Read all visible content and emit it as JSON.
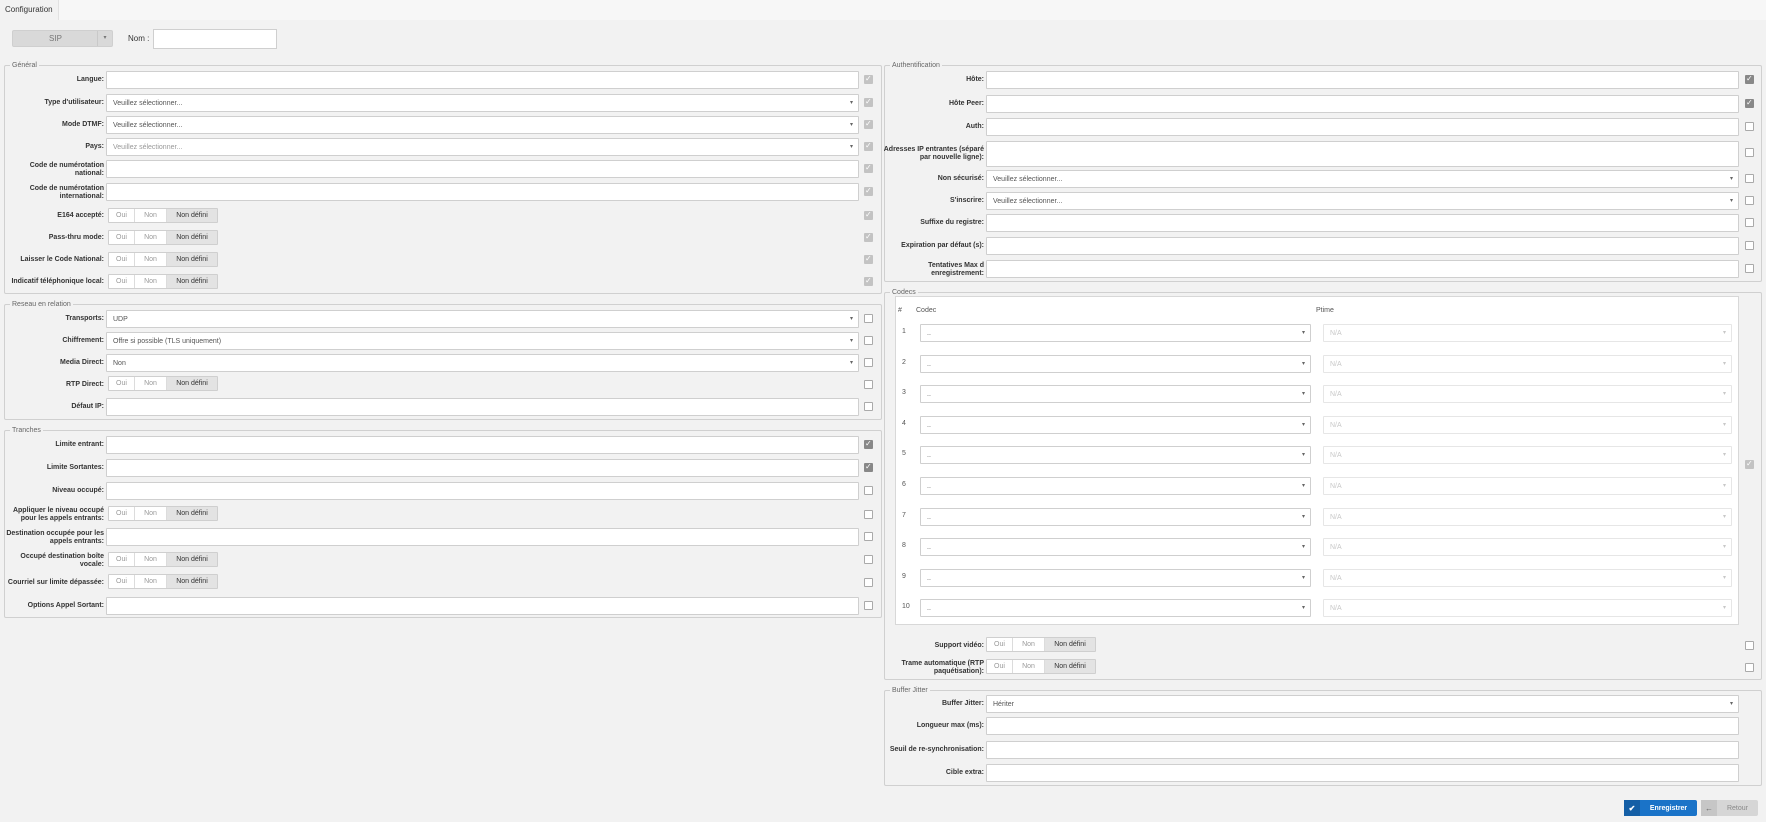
{
  "tab": "Configuration",
  "protocol": "SIP",
  "name_label": "Nom :",
  "name_value": "",
  "tri_labels": {
    "oui": "Oui",
    "non": "Non",
    "nd": "Non défini"
  },
  "general": {
    "legend": "Général",
    "langue": "Langue:",
    "type_util": "Type d'utilisateur:",
    "type_util_value": "Veuillez sélectionner...",
    "dtmf": "Mode DTMF:",
    "dtmf_value": "Veuillez sélectionner...",
    "pays": "Pays:",
    "pays_value": "Veuillez sélectionner...",
    "code_nat": "Code de numérotation national:",
    "code_int": "Code de numérotation international:",
    "e164": "E164 accepté:",
    "passthru": "Pass-thru mode:",
    "laisser": "Laisser le Code National:",
    "indicatif": "Indicatif téléphonique local:"
  },
  "reseau": {
    "legend": "Reseau en relation",
    "transports": "Transports:",
    "transports_value": "UDP",
    "chiffrement": "Chiffrement:",
    "chiffrement_value": "Offre si possible (TLS uniquement)",
    "media": "Media Direct:",
    "media_value": "Non",
    "rtp": "RTP Direct:",
    "defaut_ip": "Défaut IP:"
  },
  "tranches": {
    "legend": "Tranches",
    "limite_entrant": "Limite entrant:",
    "limite_sortantes": "Limite Sortantes:",
    "niveau": "Niveau occupé:",
    "appliquer": "Appliquer le niveau occupé pour les appels entrants:",
    "destination": "Destination occupée pour les appels entrants:",
    "occupe_boite": "Occupé destination boîte vocale:",
    "courriel": "Courriel sur limite dépassée:",
    "options": "Options Appel Sortant:"
  },
  "auth": {
    "legend": "Authentification",
    "hote": "Hôte:",
    "hote_peer": "Hôte Peer:",
    "auth": "Auth:",
    "adresses": "Adresses IP entrantes (séparé par nouvelle ligne):",
    "non_securise": "Non sécurisé:",
    "non_securise_value": "Veuillez sélectionner...",
    "sinscrire": "S'inscrire:",
    "sinscrire_value": "Veuillez sélectionner...",
    "suffixe": "Suffixe du registre:",
    "expiration": "Expiration par défaut (s):",
    "tentatives": "Tentatives Max d enregistrement:"
  },
  "codecs": {
    "legend": "Codecs",
    "col_num": "#",
    "col_codec": "Codec",
    "col_ptime": "Ptime",
    "rows": [
      {
        "num": "1",
        "codec": "..",
        "ptime": "N/A"
      },
      {
        "num": "2",
        "codec": "..",
        "ptime": "N/A"
      },
      {
        "num": "3",
        "codec": "..",
        "ptime": "N/A"
      },
      {
        "num": "4",
        "codec": "..",
        "ptime": "N/A"
      },
      {
        "num": "5",
        "codec": "..",
        "ptime": "N/A"
      },
      {
        "num": "6",
        "codec": "..",
        "ptime": "N/A"
      },
      {
        "num": "7",
        "codec": "..",
        "ptime": "N/A"
      },
      {
        "num": "8",
        "codec": "..",
        "ptime": "N/A"
      },
      {
        "num": "9",
        "codec": "..",
        "ptime": "N/A"
      },
      {
        "num": "10",
        "codec": "..",
        "ptime": "N/A"
      }
    ],
    "support_video": "Support vidéo:",
    "trame": "Trame automatique (RTP paquétisation):"
  },
  "jitter": {
    "legend": "Buffer Jitter",
    "buffer": "Buffer Jitter:",
    "buffer_value": "Hériter",
    "longueur": "Longueur max (ms):",
    "seuil": "Seuil de re-synchronisation:",
    "cible": "Cible extra:"
  },
  "buttons": {
    "save": "Enregistrer",
    "back": "Retour"
  },
  "colors": {
    "primary": "#1a73c8",
    "background": "#f2f2f2"
  }
}
